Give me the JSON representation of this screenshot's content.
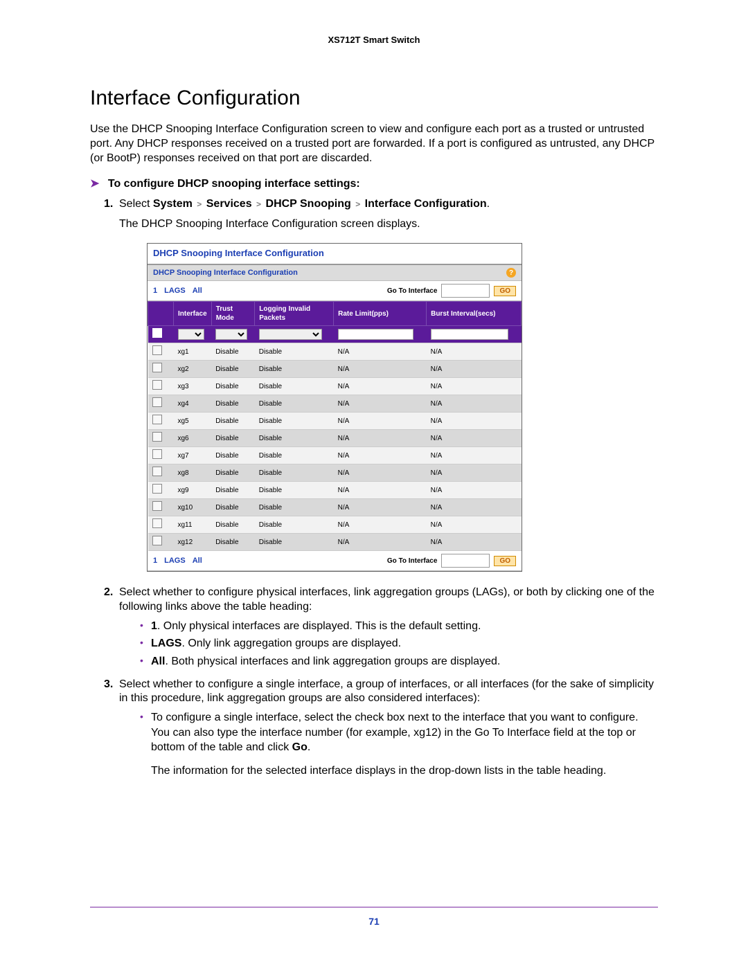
{
  "doc_header": "XS712T Smart Switch",
  "title": "Interface Configuration",
  "intro": "Use the DHCP Snooping Interface Configuration screen to view and configure each port as a trusted or untrusted port. Any DHCP responses received on a trusted port are forwarded. If a port is configured as untrusted, any DHCP (or BootP) responses received on that port are discarded.",
  "proc_heading": "To configure DHCP snooping interface settings:",
  "step1_prefix": "Select ",
  "step1_bold": "System > Services > DHCP Snooping > Interface Configuration",
  "step1_period": ".",
  "step1_note": "The DHCP Snooping Interface Configuration screen displays.",
  "ui": {
    "panel_title": "DHCP Snooping Interface Configuration",
    "sub_title": "DHCP Snooping Interface Configuration",
    "nav": {
      "n1": "1",
      "lags": "LAGS",
      "all": "All"
    },
    "goto_label": "Go To Interface",
    "go": "GO",
    "headers": {
      "iface": "Interface",
      "trust": "Trust Mode",
      "log": "Logging Invalid Packets",
      "rate": "Rate Limit(pps)",
      "burst": "Burst Interval(secs)"
    },
    "rows": [
      {
        "if": "xg1",
        "tm": "Disable",
        "lg": "Disable",
        "rl": "N/A",
        "bi": "N/A"
      },
      {
        "if": "xg2",
        "tm": "Disable",
        "lg": "Disable",
        "rl": "N/A",
        "bi": "N/A"
      },
      {
        "if": "xg3",
        "tm": "Disable",
        "lg": "Disable",
        "rl": "N/A",
        "bi": "N/A"
      },
      {
        "if": "xg4",
        "tm": "Disable",
        "lg": "Disable",
        "rl": "N/A",
        "bi": "N/A"
      },
      {
        "if": "xg5",
        "tm": "Disable",
        "lg": "Disable",
        "rl": "N/A",
        "bi": "N/A"
      },
      {
        "if": "xg6",
        "tm": "Disable",
        "lg": "Disable",
        "rl": "N/A",
        "bi": "N/A"
      },
      {
        "if": "xg7",
        "tm": "Disable",
        "lg": "Disable",
        "rl": "N/A",
        "bi": "N/A"
      },
      {
        "if": "xg8",
        "tm": "Disable",
        "lg": "Disable",
        "rl": "N/A",
        "bi": "N/A"
      },
      {
        "if": "xg9",
        "tm": "Disable",
        "lg": "Disable",
        "rl": "N/A",
        "bi": "N/A"
      },
      {
        "if": "xg10",
        "tm": "Disable",
        "lg": "Disable",
        "rl": "N/A",
        "bi": "N/A"
      },
      {
        "if": "xg11",
        "tm": "Disable",
        "lg": "Disable",
        "rl": "N/A",
        "bi": "N/A"
      },
      {
        "if": "xg12",
        "tm": "Disable",
        "lg": "Disable",
        "rl": "N/A",
        "bi": "N/A"
      }
    ]
  },
  "step2": "Select whether to configure physical interfaces, link aggregation groups (LAGs), or both by clicking one of the following links above the table heading:",
  "bullets2": {
    "b1_bold": "1",
    "b1_rest": ". Only physical interfaces are displayed. This is the default setting.",
    "b2_bold": "LAGS",
    "b2_rest": ". Only link aggregation groups are displayed.",
    "b3_bold": "All",
    "b3_rest": ". Both physical interfaces and link aggregation groups are displayed."
  },
  "step3": "Select whether to configure a single interface, a group of interfaces, or all interfaces (for the sake of simplicity in this procedure, link aggregation groups are also considered interfaces):",
  "bullets3": {
    "p1a": "To configure a single interface, select the check box next to the interface that you want to configure. You can also type the interface number (for example, xg12) in the Go To Interface field at the top or bottom of the table and click ",
    "p1b": "Go",
    "p1c": ".",
    "p2": "The information for the selected interface displays in the drop-down lists in the table heading."
  },
  "page_number": "71"
}
